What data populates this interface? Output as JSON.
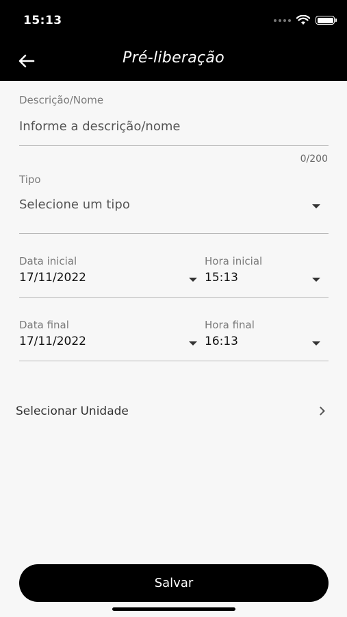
{
  "status_bar": {
    "time": "15:13"
  },
  "header": {
    "title": "Pré-liberação"
  },
  "form": {
    "description": {
      "label": "Descrição/Nome",
      "placeholder": "Informe a descrição/nome",
      "counter": "0/200"
    },
    "type": {
      "label": "Tipo",
      "placeholder": "Selecione um tipo"
    },
    "start_date": {
      "label": "Data inicial",
      "value": "17/11/2022"
    },
    "start_time": {
      "label": "Hora inicial",
      "value": "15:13"
    },
    "end_date": {
      "label": "Data final",
      "value": "17/11/2022"
    },
    "end_time": {
      "label": "Hora final",
      "value": "16:13"
    },
    "unit_selector": {
      "label": "Selecionar Unidade"
    }
  },
  "actions": {
    "save_label": "Salvar"
  }
}
